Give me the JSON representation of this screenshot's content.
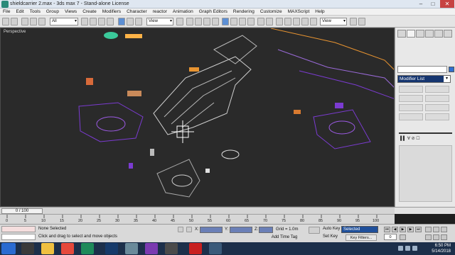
{
  "window": {
    "title": "shieldcarrier 2.max - 3ds max 7 - Stand-alone License",
    "buttons": {
      "minimize": "–",
      "maximize": "□",
      "close": "✕"
    }
  },
  "menu": [
    "File",
    "Edit",
    "Tools",
    "Group",
    "Views",
    "Create",
    "Modifiers",
    "Character",
    "reactor",
    "Animation",
    "Graph Editors",
    "Rendering",
    "Customize",
    "MAXScript",
    "Help"
  ],
  "toolbar": {
    "selection_filter": "All",
    "ref_coord_1": "View",
    "ref_coord_2": "View",
    "named_selection": ""
  },
  "viewport": {
    "label": "Perspective",
    "accent": "#7b3bd1",
    "highlight": "#e89431"
  },
  "command_panel": {
    "object_name": "",
    "modifier_list": "Modifier List",
    "dropdown_arrow": "▾"
  },
  "timeline": {
    "slider_label": "0 / 100",
    "ticks": [
      "0",
      "5",
      "10",
      "15",
      "20",
      "25",
      "30",
      "35",
      "40",
      "45",
      "50",
      "55",
      "60",
      "65",
      "70",
      "75",
      "80",
      "85",
      "90",
      "95",
      "100"
    ]
  },
  "status": {
    "selection": "None Selected",
    "prompt": "Click and drag to select and move objects",
    "x_label": "X:",
    "y_label": "Y:",
    "z_label": "Z:",
    "grid": "Grid = 1.0m",
    "add_time_tag": "Add Time Tag",
    "auto_key": "Auto Key",
    "selected_option": "Selected",
    "set_key": "Set Key",
    "key_filters": "Key Filters...",
    "frame": "0"
  },
  "taskbar": {
    "time": "6:50 PM",
    "date": "5/14/2018"
  }
}
